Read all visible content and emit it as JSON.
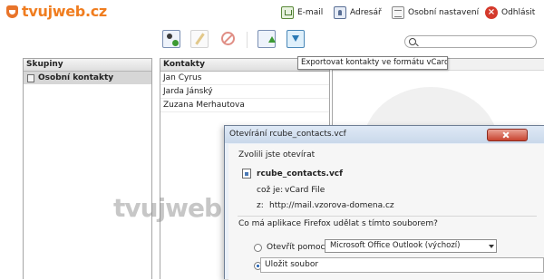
{
  "header": {
    "logo": "tvujweb.cz",
    "nav": [
      {
        "label": "E-mail",
        "icon": "email-icon"
      },
      {
        "label": "Adresář",
        "icon": "address-book-icon"
      },
      {
        "label": "Osobní nastavení",
        "icon": "settings-icon"
      },
      {
        "label": "Odhlásit",
        "icon": "logout-icon"
      }
    ]
  },
  "toolbar": {
    "buttons": [
      "add-contact-icon",
      "edit-icon",
      "delete-icon",
      "import-icon",
      "export-icon"
    ],
    "tooltip": "Exportovat kontakty ve formátu vCard"
  },
  "groups": {
    "header": "Skupiny",
    "items": [
      "Osobní kontakty"
    ]
  },
  "contacts": {
    "header": "Kontakty",
    "items": [
      "Jan Cyrus",
      "Jarda Jánský",
      "Zuzana Merhautova"
    ]
  },
  "watermark": "tvujweb.cz",
  "dialog": {
    "title": "Otevírání rcube_contacts.vcf",
    "intro": "Zvolili jste otevírat",
    "filename": "rcube_contacts.vcf",
    "type_label": "což je:",
    "type_value": "vCard File",
    "from_label": "z:",
    "from_value": "http://mail.vzorova-domena.cz",
    "question": "Co má aplikace Firefox udělat s tímto souborem?",
    "open_with_label": "Otevřít pomocí",
    "open_with_value": "Microsoft Office Outlook (výchozí)",
    "save_label": "Uložit soubor"
  },
  "colors": {
    "brand": "#f07d1f",
    "logout": "#d4392b"
  }
}
